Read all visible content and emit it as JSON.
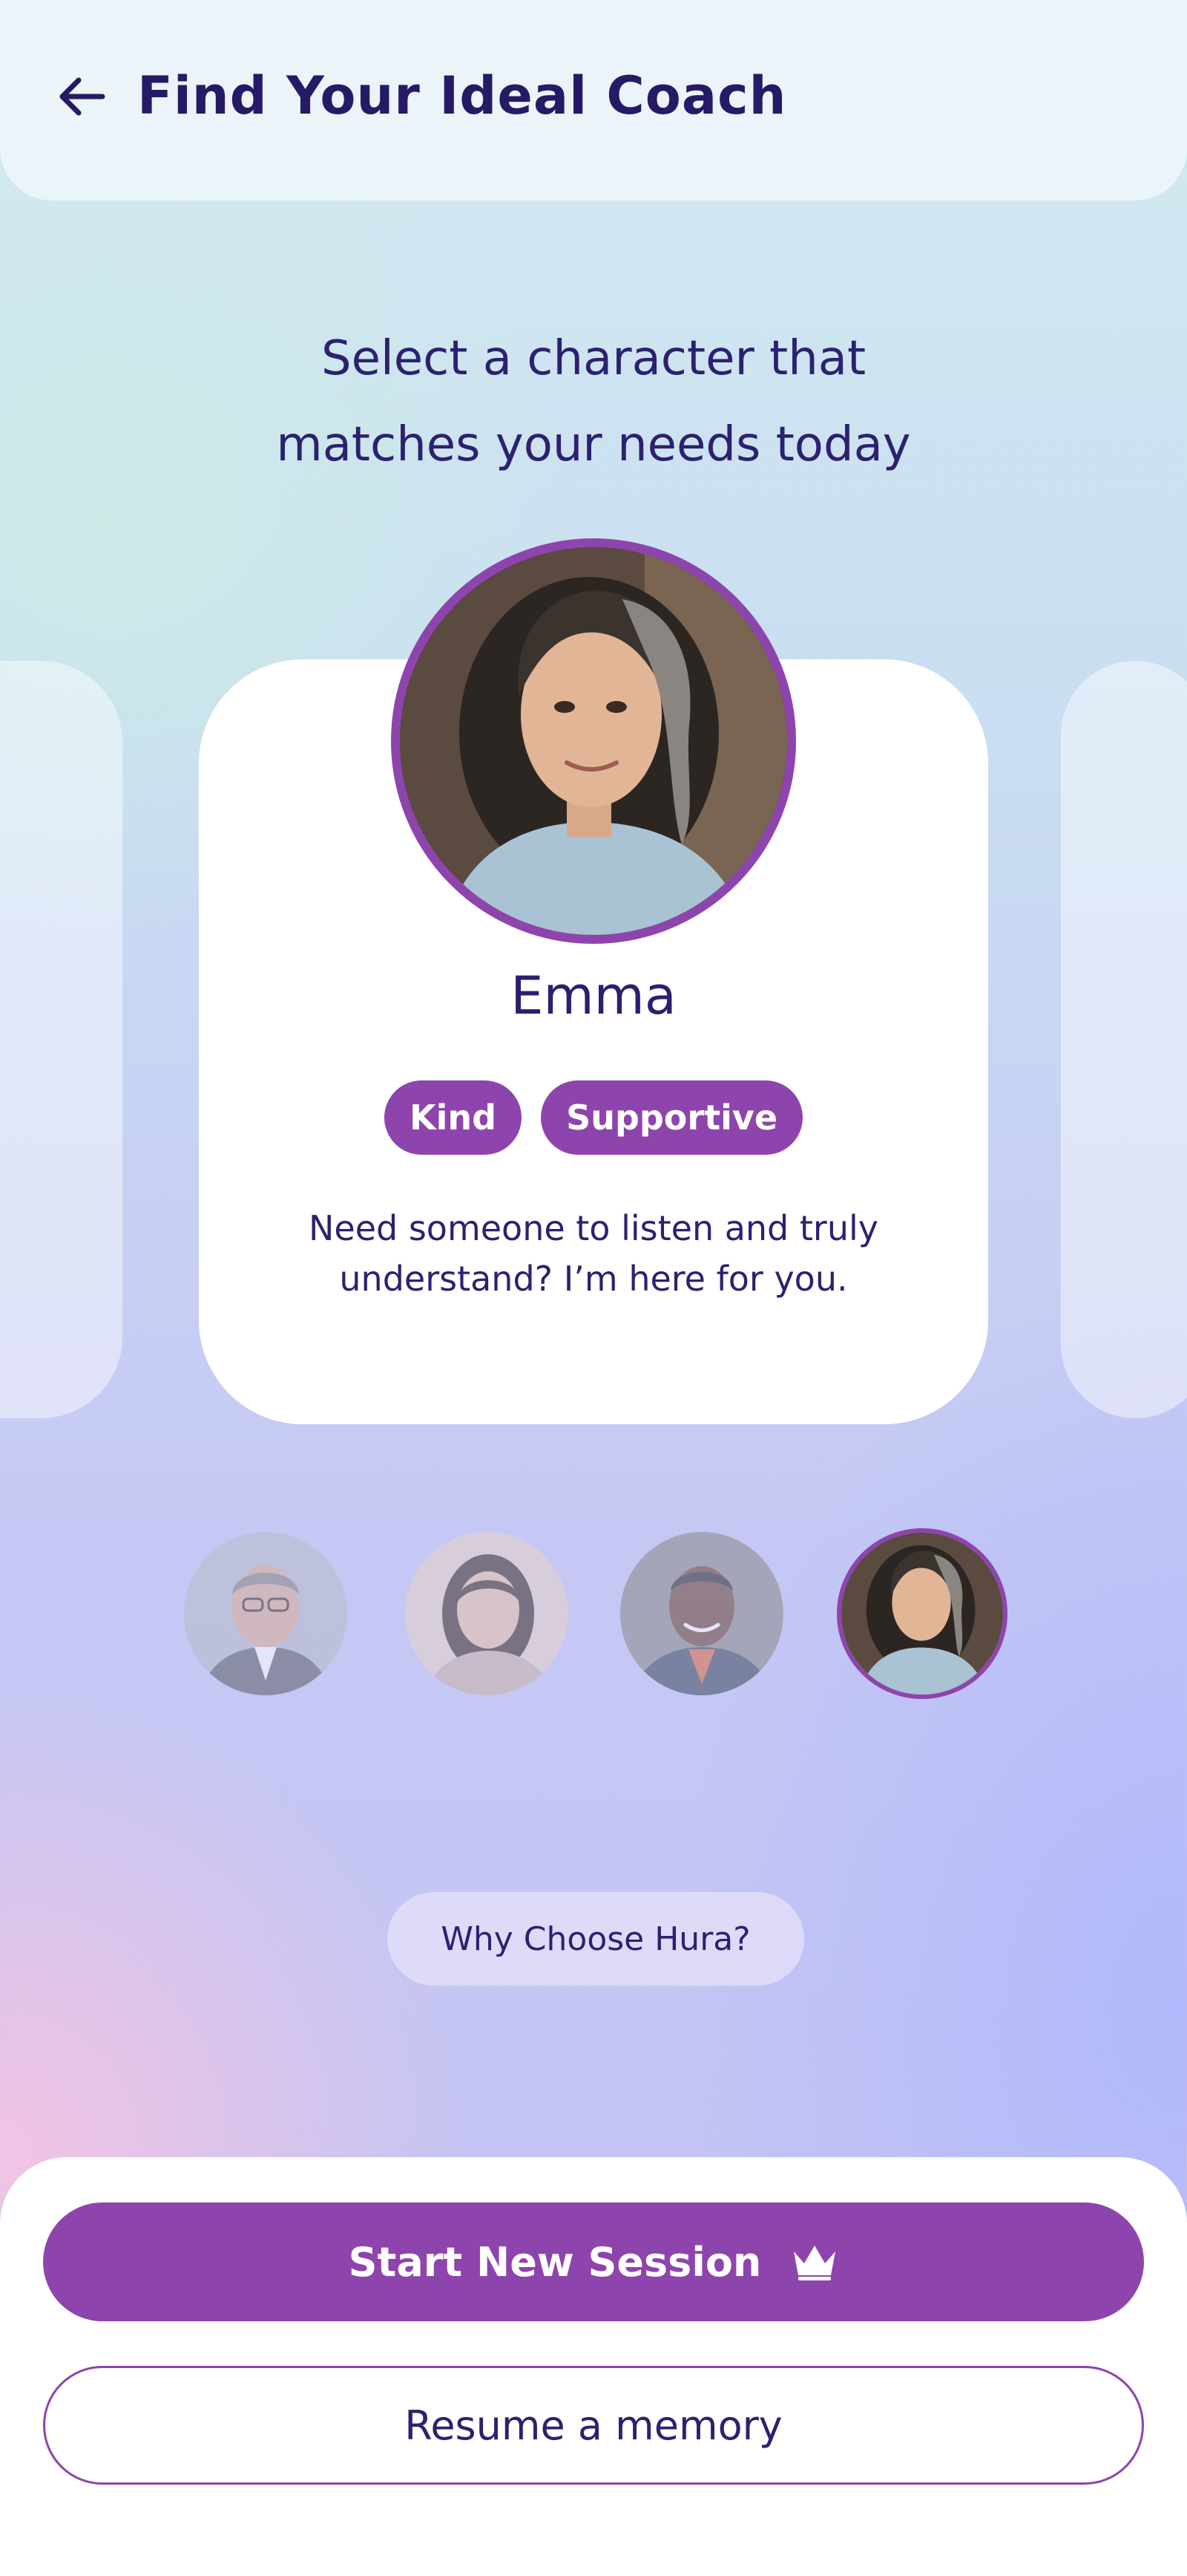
{
  "header": {
    "back_icon": "arrow-left-icon",
    "title": "Find Your Ideal Coach"
  },
  "subtitle": {
    "line1": "Select a character that",
    "line2": "matches your needs today"
  },
  "selected_coach": {
    "name": "Emma",
    "tags": [
      "Kind",
      "Supportive"
    ],
    "description_line1": "Need someone to listen and truly",
    "description_line2": "understand? I’m here for you."
  },
  "coach_thumbnails": [
    {
      "id": "coach-1",
      "selected": false
    },
    {
      "id": "coach-2",
      "selected": false
    },
    {
      "id": "coach-3",
      "selected": false
    },
    {
      "id": "emma",
      "selected": true
    }
  ],
  "why_link": "Why Choose Hura?",
  "actions": {
    "start_label": "Start New Session",
    "start_icon": "crown-icon",
    "resume_label": "Resume a memory"
  },
  "colors": {
    "accent": "#8e44ad",
    "text_dark": "#251a66",
    "card_bg": "#ffffff"
  }
}
